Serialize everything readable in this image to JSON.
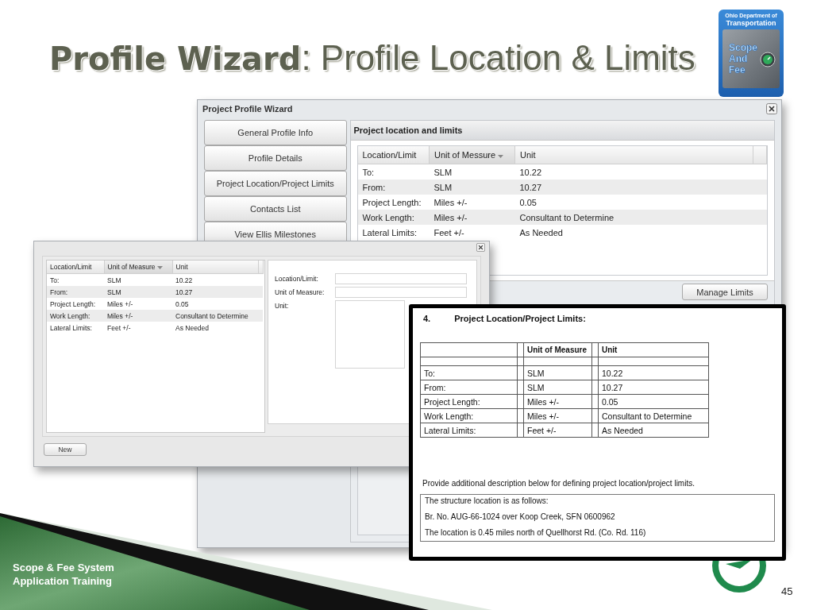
{
  "slide": {
    "title": "**Profile Wizard**: Profile Location & Limits",
    "logo": {
      "header": [
        "Ohio Department of",
        "Transportation"
      ],
      "badge": [
        "Scope",
        "And",
        "Fee"
      ]
    },
    "footer": [
      "Scope & Fee System",
      "Application Training"
    ],
    "page_number": "45"
  },
  "wizard_window": {
    "title": "Project Profile Wizard",
    "nav": [
      "General Profile Info",
      "Profile Details",
      "Project Location/Project Limits",
      "Contacts List",
      "View Ellis Milestones"
    ],
    "panel_title": "Project location and limits",
    "columns": [
      {
        "label": "Location/Limit",
        "sorted": false
      },
      {
        "label": "Unit of Messure",
        "sorted": true
      },
      {
        "label": "Unit",
        "sorted": false
      }
    ],
    "rows": [
      [
        "To:",
        "SLM",
        "10.22"
      ],
      [
        "From:",
        "SLM",
        "10.27"
      ],
      [
        "Project Length:",
        "Miles +/-",
        "0.05"
      ],
      [
        "Work Length:",
        "Miles +/-",
        "Consultant to Determine"
      ],
      [
        "Lateral Limits:",
        "Feet +/-",
        "As Needed"
      ]
    ],
    "button": "Manage Limits"
  },
  "limits_dialog": {
    "columns": [
      {
        "label": "Location/Limit",
        "sorted": false
      },
      {
        "label": "Unit of Measure",
        "sorted": true
      },
      {
        "label": "Unit",
        "sorted": false
      }
    ],
    "rows": [
      [
        "To:",
        "SLM",
        "10.22"
      ],
      [
        "From:",
        "SLM",
        "10.27"
      ],
      [
        "Project Length:",
        "Miles +/-",
        "0.05"
      ],
      [
        "Work Length:",
        "Miles +/-",
        "Consultant to Determine"
      ],
      [
        "Lateral Limits:",
        "Feet +/-",
        "As Needed"
      ]
    ],
    "form_labels": [
      "Location/Limit:",
      "Unit of Measure:",
      "Unit:"
    ],
    "button": "New"
  },
  "document": {
    "number": "4.",
    "heading": "Project Location/Project Limits:",
    "columns": [
      "",
      "Unit of Measure",
      "Unit"
    ],
    "rows": [
      [
        "To:",
        "SLM",
        "10.22"
      ],
      [
        "From:",
        "SLM",
        "10.27"
      ],
      [
        "Project Length:",
        "Miles +/-",
        "0.05"
      ],
      [
        "Work Length:",
        "Miles +/-",
        "Consultant to Determine"
      ],
      [
        "Lateral Limits:",
        "Feet +/-",
        "As Needed"
      ]
    ],
    "instruction": "Provide additional description below for defining project location/project limits.",
    "description": [
      "The structure location is as follows:",
      "Br. No. AUG-66-1024 over Koop Creek, SFN 0600962",
      "The location is 0.45 miles north of Quellhorst Rd. (Co. Rd. 116)"
    ]
  }
}
